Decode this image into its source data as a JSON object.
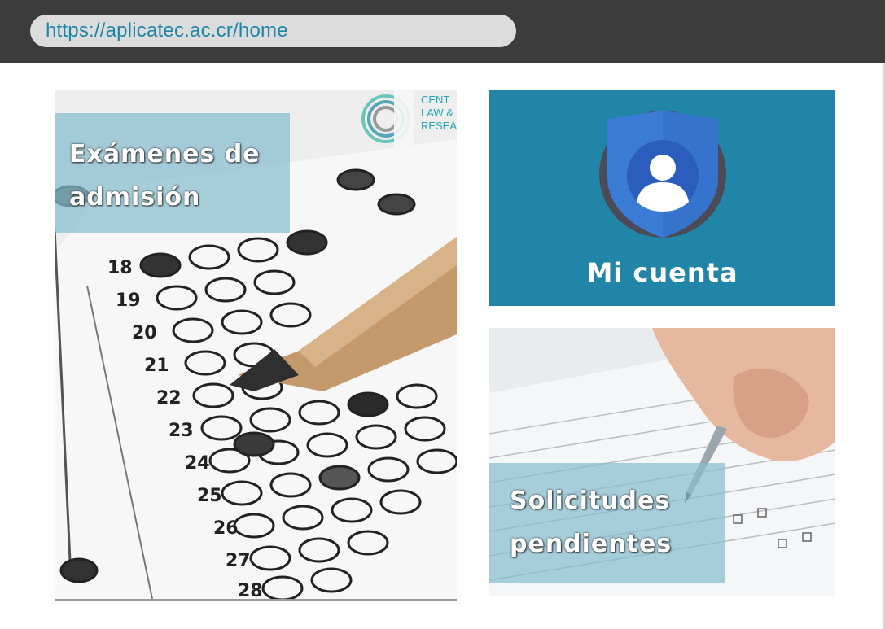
{
  "browser": {
    "url": "https://aplicatec.ac.cr/home"
  },
  "cards": {
    "exams": {
      "title_line1": "Exámenes de",
      "title_line2": "admisión",
      "logo_lines": [
        "CENT",
        "LAW &",
        "RESEA"
      ],
      "image": "pencil-on-answer-sheet"
    },
    "account": {
      "title": "Mi cuenta",
      "icon": "user-shield-icon"
    },
    "requests": {
      "title_line1": "Solicitudes",
      "title_line2": "pendientes",
      "image": "hand-filling-form"
    }
  },
  "colors": {
    "topbar": "#3c3c3c",
    "url_text": "#1f86a8",
    "account_bg": "#2185a8",
    "label_overlay": "#86bcce"
  }
}
